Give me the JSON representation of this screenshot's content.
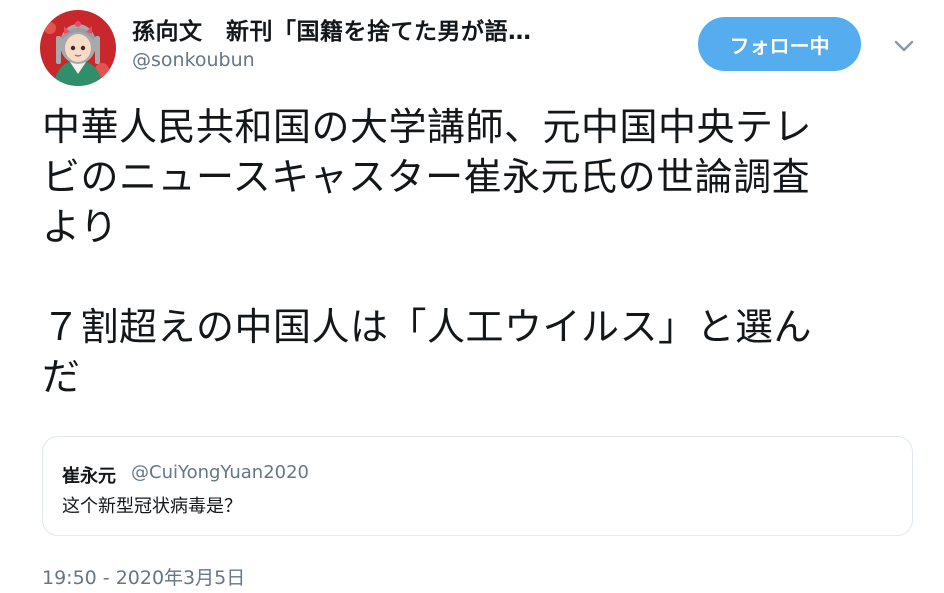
{
  "author": {
    "display_name": "孫向文　新刊「国籍を捨てた男が語…",
    "handle": "@sonkoubun",
    "avatar_icon": "avatar-illustration-icon"
  },
  "follow_button": {
    "label": "フォロー中",
    "color": "#55acee"
  },
  "menu_icon": "chevron-down-icon",
  "tweet": {
    "lines": [
      "中華人民共和国の大学講師、元中国中央テレ",
      "ビのニュースキャスター崔永元氏の世論調査",
      "より",
      "７割超えの中国人は「人工ウイルス」と選ん",
      "だ"
    ]
  },
  "quoted_tweet": {
    "name": "崔永元",
    "handle": "@CuiYongYuan2020",
    "text": "这个新型冠状病毒是？"
  },
  "timestamp": "19:50 - 2020年3月5日",
  "colors": {
    "text": "#14171a",
    "secondary": "#657786",
    "border": "#e1e8ed"
  }
}
